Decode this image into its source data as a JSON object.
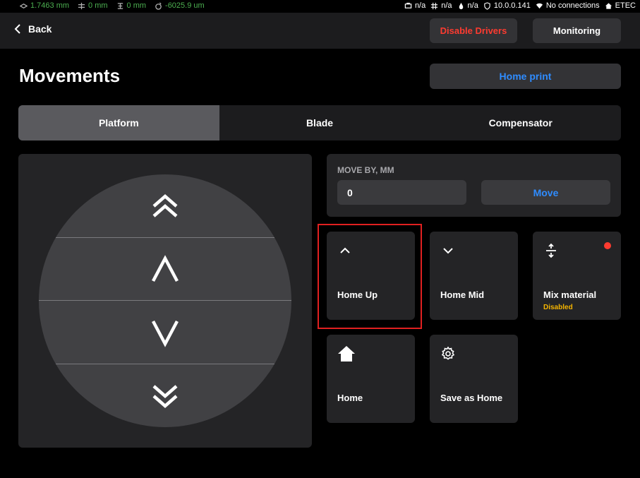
{
  "status_bar": {
    "pos1": "1.7463 mm",
    "pos2": "0 mm",
    "pos3": "0 mm",
    "pos4": "-6025.9 um",
    "s1": "n/a",
    "s2": "n/a",
    "s3": "n/a",
    "ip": "10.0.0.141",
    "connection": "No connections",
    "device": "ETEC"
  },
  "header": {
    "back_label": "Back",
    "disable_drivers_label": "Disable Drivers",
    "monitoring_label": "Monitoring"
  },
  "page": {
    "title": "Movements",
    "home_print_label": "Home print"
  },
  "tabs": [
    {
      "label": "Platform",
      "active": true
    },
    {
      "label": "Blade",
      "active": false
    },
    {
      "label": "Compensator",
      "active": false
    }
  ],
  "move_by": {
    "label": "MOVE BY, MM",
    "value": "0",
    "button_label": "Move"
  },
  "cards": [
    {
      "label": "Home Up",
      "icon": "chevron-up-icon"
    },
    {
      "label": "Home Mid",
      "icon": "chevron-down-icon"
    },
    {
      "label": "Mix material",
      "icon": "mix-arrows-icon",
      "sub": "Disabled"
    },
    {
      "label": "Home",
      "icon": "home-icon"
    },
    {
      "label": "Save as Home",
      "icon": "gear-icon"
    }
  ],
  "colors": {
    "accent_blue": "#2f8cff",
    "danger_red": "#ff3b30",
    "warning_yellow": "#f5b400",
    "position_green": "#4caf50"
  }
}
